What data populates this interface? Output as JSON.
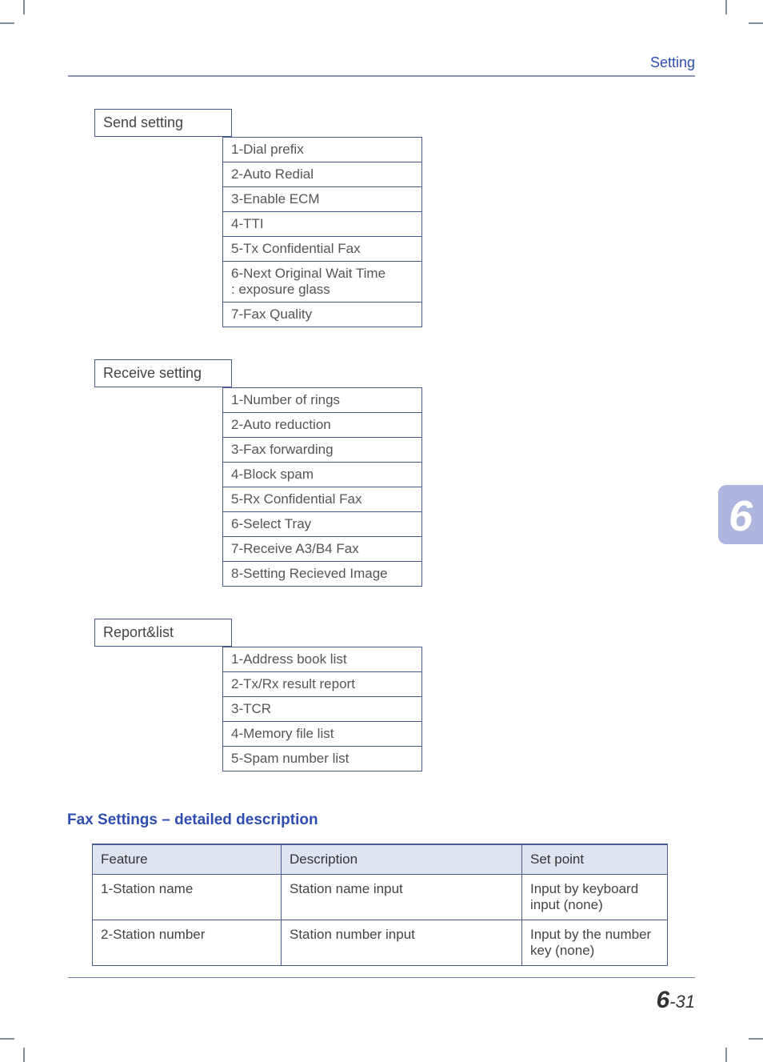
{
  "header": {
    "section_title": "Setting"
  },
  "chapter_tab": "6",
  "page_number": {
    "chapter": "6",
    "sep": "-",
    "page": "31"
  },
  "groups": [
    {
      "title": "Send setting",
      "items": [
        "1-Dial prefix",
        "2-Auto Redial",
        "3-Enable ECM",
        "4-TTI",
        "5-Tx Confidential Fax",
        "6-Next Original Wait Time\n    : exposure glass",
        "7-Fax Quality"
      ]
    },
    {
      "title": "Receive setting",
      "items": [
        "1-Number of rings",
        "2-Auto reduction",
        "3-Fax forwarding",
        "4-Block spam",
        "5-Rx Confidential Fax",
        "6-Select Tray",
        "7-Receive A3/B4 Fax",
        "8-Setting Recieved Image"
      ]
    },
    {
      "title": "Report&list",
      "items": [
        "1-Address book list",
        "2-Tx/Rx result report",
        "3-TCR",
        "4-Memory file list",
        "5-Spam number list"
      ]
    }
  ],
  "subsection_title": "Fax Settings – detailed description",
  "table": {
    "headers": [
      "Feature",
      "Description",
      "Set point"
    ],
    "rows": [
      {
        "feature": "1-Station name",
        "description": "Station name input",
        "setpoint": "Input by keyboard input (none)"
      },
      {
        "feature": "2-Station number",
        "description": "Station number input",
        "setpoint": "Input by the number key (none)"
      }
    ]
  }
}
